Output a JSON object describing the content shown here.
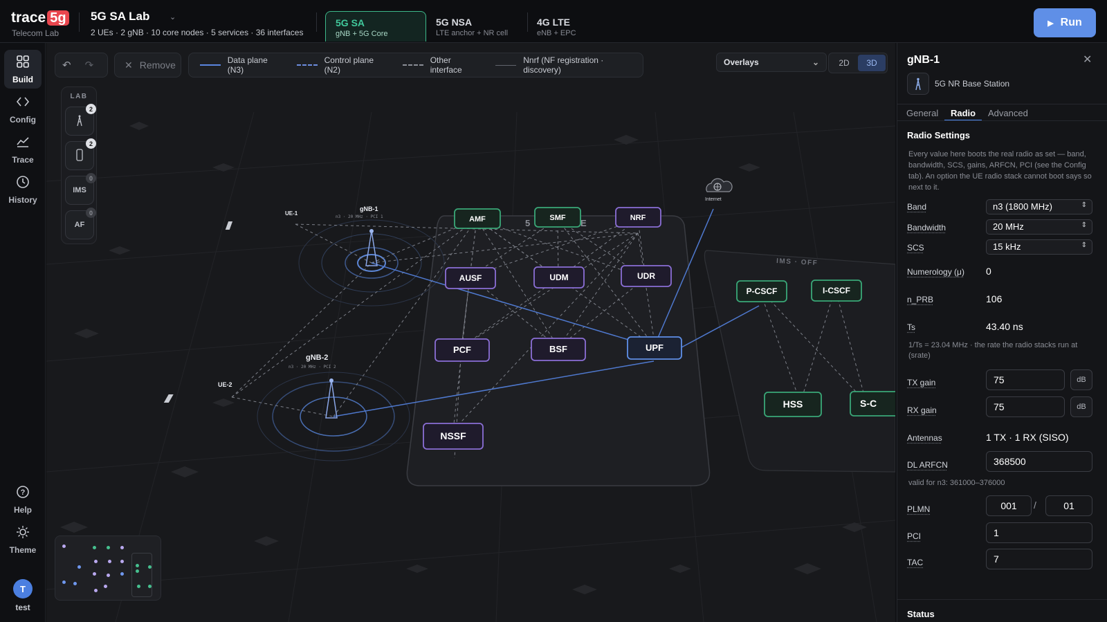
{
  "brand": {
    "name": "trace",
    "badge": "5g",
    "subtitle": "Telecom Lab"
  },
  "project": {
    "title": "5G SA Lab",
    "summary": "2 UEs · 2 gNB · 10 core nodes · 5 services · 36 interfaces"
  },
  "modes": [
    {
      "label": "5G SA",
      "sub": "gNB + 5G Core",
      "active": true
    },
    {
      "label": "5G NSA",
      "sub": "LTE anchor + NR cell"
    },
    {
      "label": "4G LTE",
      "sub": "eNB + EPC"
    }
  ],
  "run_label": "Run",
  "nav": [
    {
      "label": "Build",
      "icon": "grid-icon"
    },
    {
      "label": "Config",
      "icon": "code-icon"
    },
    {
      "label": "Trace",
      "icon": "chart-icon"
    },
    {
      "label": "History",
      "icon": "clock-icon"
    },
    {
      "label": "Help",
      "icon": "help-icon"
    },
    {
      "label": "Theme",
      "icon": "sun-icon"
    }
  ],
  "user": {
    "initial": "T",
    "name": "test"
  },
  "toolbar": {
    "remove_label": "Remove",
    "legend": [
      {
        "label": "Data plane (N3)"
      },
      {
        "label": "Control plane (N2)"
      },
      {
        "label": "Other interface"
      },
      {
        "label": "Nnrf (NF registration · discovery)"
      }
    ],
    "overlays_label": "Overlays",
    "dim_2d": "2D",
    "dim_3d": "3D"
  },
  "lab": {
    "title": "LAB",
    "items": [
      {
        "name": "gnb-tool",
        "count": "2",
        "label": ""
      },
      {
        "name": "ue-tool",
        "count": "2",
        "label": ""
      },
      {
        "name": "ims-tool",
        "count": "0",
        "label": "IMS"
      },
      {
        "name": "af-tool",
        "count": "0",
        "label": "AF"
      }
    ]
  },
  "network": {
    "core_nodes": [
      "AMF",
      "SMF",
      "NRF",
      "AUSF",
      "UDM",
      "UDR",
      "PCF",
      "BSF",
      "UPF",
      "NSSF"
    ],
    "ims_label": "IMS · OFF",
    "ims_nodes": [
      "P-CSCF",
      "I-CSCF",
      "HSS",
      "S-C"
    ],
    "core_fragment_left": "5",
    "core_fragment_right": "E",
    "gnb1": {
      "name": "gNB-1",
      "info": "n3 · 20 MHz · PCI 1"
    },
    "gnb2": {
      "name": "gNB-2",
      "info": "n3 · 20 MHz · PCI 2"
    },
    "ue1": "UE-1",
    "ue2": "UE-2",
    "internet": "Internet"
  },
  "panel": {
    "title": "gNB-1",
    "subtitle": "5G NR Base Station",
    "tabs": [
      "General",
      "Radio",
      "Advanced"
    ],
    "active_tab": "Radio",
    "section": "Radio Settings",
    "description": "Every value here boots the real radio as set — band, bandwidth, SCS, gains, ARFCN, PCI (see the Config tab). An option the UE radio stack cannot boot says so next to it.",
    "band_label": "Band",
    "band_value": "n3 (1800 MHz)",
    "bw_label": "Bandwidth",
    "bw_value": "20 MHz",
    "scs_label": "SCS",
    "scs_value": "15 kHz",
    "numerology_label": "Numerology (μ)",
    "numerology_value": "0",
    "nprb_label": "n_PRB",
    "nprb_value": "106",
    "ts_label": "Ts",
    "ts_value": "43.40 ns",
    "ts_note": "1/Ts = 23.04 MHz · the rate the radio stacks run at (srate)",
    "txgain_label": "TX gain",
    "txgain_value": "75",
    "rxgain_label": "RX gain",
    "rxgain_value": "75",
    "gain_unit": "dB",
    "antennas_label": "Antennas",
    "antennas_value": "1 TX · 1 RX (SISO)",
    "arfcn_label": "DL ARFCN",
    "arfcn_value": "368500",
    "arfcn_note": "valid for n3: 361000–376000",
    "plmn_label": "PLMN",
    "plmn_mcc": "001",
    "plmn_mnc": "01",
    "pci_label": "PCI",
    "pci_value": "1",
    "tac_label": "TAC",
    "tac_value": "7",
    "status_label": "Status"
  },
  "colors": {
    "accent": "#5f8fe7",
    "green": "#3db98a",
    "purple": "#8b6fd6",
    "teal": "#3aa878"
  }
}
